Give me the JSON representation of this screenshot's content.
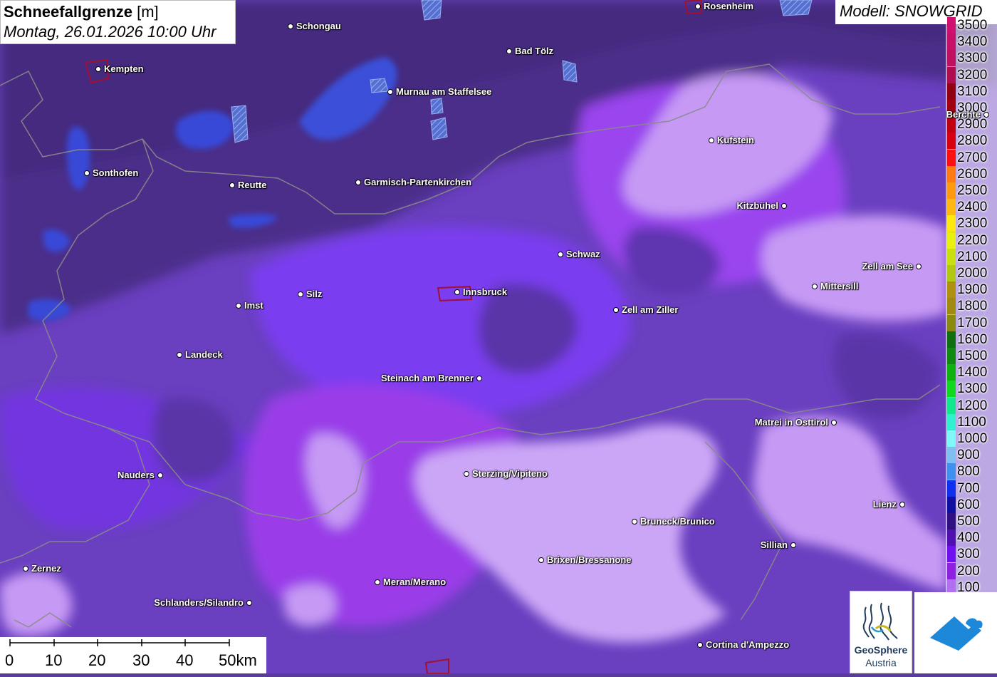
{
  "title": {
    "main": "Schneefallgrenze",
    "unit": "[m]",
    "datetime": "Montag, 26.01.2026 10:00 Uhr"
  },
  "model": "Modell: SNOWGRID",
  "legend": [
    {
      "label": "3500",
      "color": "#d01070"
    },
    {
      "label": "3400",
      "color": "#c81068"
    },
    {
      "label": "3300",
      "color": "#c01060"
    },
    {
      "label": "3200",
      "color": "#b00c50"
    },
    {
      "label": "3100",
      "color": "#900010"
    },
    {
      "label": "3000",
      "color": "#a00010"
    },
    {
      "label": "2900",
      "color": "#c00010"
    },
    {
      "label": "2800",
      "color": "#d80010"
    },
    {
      "label": "2700",
      "color": "#ff1010"
    },
    {
      "label": "2600",
      "color": "#ff7a10"
    },
    {
      "label": "2500",
      "color": "#ff9a10"
    },
    {
      "label": "2400",
      "color": "#ffb810"
    },
    {
      "label": "2300",
      "color": "#ffe810"
    },
    {
      "label": "2200",
      "color": "#e8f010"
    },
    {
      "label": "2100",
      "color": "#c8e010"
    },
    {
      "label": "2000",
      "color": "#b0c810"
    },
    {
      "label": "1900",
      "color": "#b09010"
    },
    {
      "label": "1800",
      "color": "#a08a10"
    },
    {
      "label": "1700",
      "color": "#8a8a10"
    },
    {
      "label": "1600",
      "color": "#107010"
    },
    {
      "label": "1500",
      "color": "#108a10"
    },
    {
      "label": "1400",
      "color": "#10b010"
    },
    {
      "label": "1300",
      "color": "#10d820"
    },
    {
      "label": "1200",
      "color": "#10e890"
    },
    {
      "label": "1100",
      "color": "#30f0d0"
    },
    {
      "label": "1000",
      "color": "#80f8f8"
    },
    {
      "label": "900",
      "color": "#80c0f0"
    },
    {
      "label": "800",
      "color": "#4090f0"
    },
    {
      "label": "700",
      "color": "#1030f0"
    },
    {
      "label": "600",
      "color": "#1010a0"
    },
    {
      "label": "500",
      "color": "#301080"
    },
    {
      "label": "400",
      "color": "#5010b0"
    },
    {
      "label": "300",
      "color": "#7010f0"
    },
    {
      "label": "200",
      "color": "#9020e0"
    },
    {
      "label": "100",
      "color": "#b070f0"
    }
  ],
  "cities": [
    {
      "name": "Rosenheim"
    },
    {
      "name": "Schongau"
    },
    {
      "name": "Kempten"
    },
    {
      "name": "Bad Tölz"
    },
    {
      "name": "Murnau am Staffelsee"
    },
    {
      "name": "Berchte"
    },
    {
      "name": "Kufstein"
    },
    {
      "name": "Sonthofen"
    },
    {
      "name": "Reutte"
    },
    {
      "name": "Garmisch-Partenkirchen"
    },
    {
      "name": "Kitzbühel"
    },
    {
      "name": "Schwaz"
    },
    {
      "name": "Zell am See"
    },
    {
      "name": "Mittersill"
    },
    {
      "name": "Innsbruck"
    },
    {
      "name": "Imst"
    },
    {
      "name": "Silz"
    },
    {
      "name": "Zell am Ziller"
    },
    {
      "name": "Landeck"
    },
    {
      "name": "Steinach am Brenner"
    },
    {
      "name": "Matrei in Osttirol"
    },
    {
      "name": "Nauders"
    },
    {
      "name": "Sterzing/Vipiteno"
    },
    {
      "name": "Lienz"
    },
    {
      "name": "Bruneck/Brunico"
    },
    {
      "name": "Sillian"
    },
    {
      "name": "Brixen/Bressanone"
    },
    {
      "name": "Zernez"
    },
    {
      "name": "Meran/Merano"
    },
    {
      "name": "Schlanders/Silandro"
    },
    {
      "name": "Cortina d'Ampezzo"
    }
  ],
  "scale": {
    "labels": [
      "0",
      "10",
      "20",
      "30",
      "40",
      "50km"
    ]
  },
  "logo": {
    "line1": "GeoSphere",
    "line2": "Austria"
  }
}
